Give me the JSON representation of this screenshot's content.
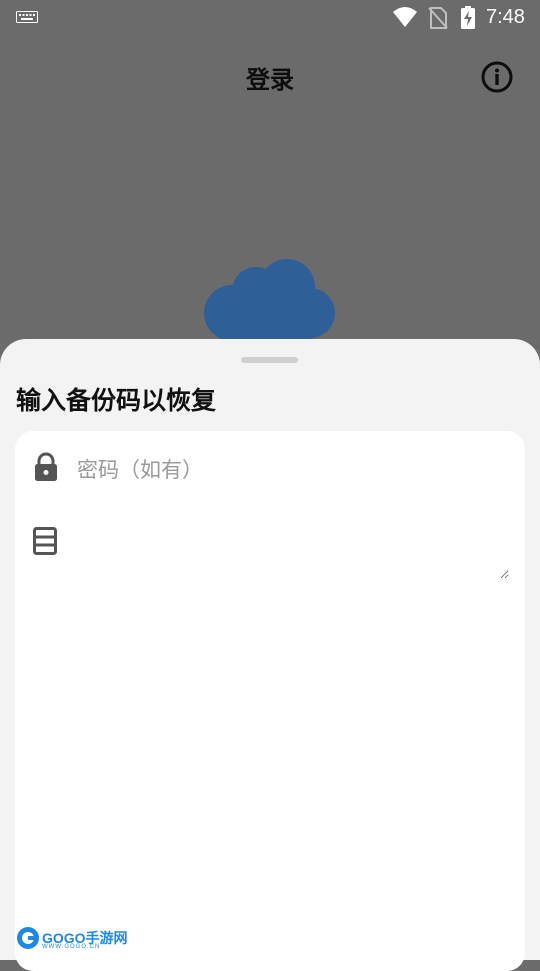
{
  "status_bar": {
    "time": "7:48",
    "icons": [
      "keyboard-icon",
      "wifi-icon",
      "no-sim-icon",
      "battery-charging-icon"
    ]
  },
  "app_bar": {
    "title": "登录",
    "info_icon": "info-icon"
  },
  "sheet": {
    "heading": "输入备份码以恢复",
    "password_field": {
      "icon": "lock-icon",
      "placeholder": "密码（如有）",
      "value": ""
    },
    "backup_field": {
      "icon": "database-icon",
      "value": ""
    }
  },
  "watermark": {
    "brand": "GOGO手游网",
    "url": "WWW.GOGO.CN"
  },
  "colors": {
    "scrim": "#6b6b6b",
    "sheet_bg": "#f3f3f3",
    "card_bg": "#ffffff",
    "logo_blue": "#2e5f96"
  }
}
